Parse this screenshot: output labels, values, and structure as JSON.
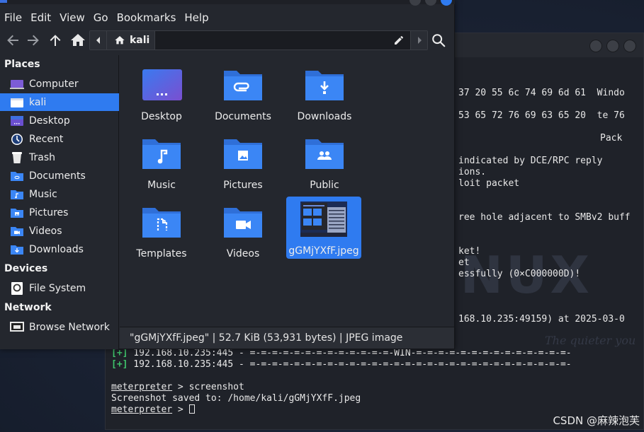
{
  "file_manager": {
    "menu": [
      "File",
      "Edit",
      "View",
      "Go",
      "Bookmarks",
      "Help"
    ],
    "path": {
      "current": "kali"
    },
    "sidebar": {
      "sections": [
        {
          "title": "Places",
          "items": [
            {
              "label": "Computer",
              "icon": "computer-icon"
            },
            {
              "label": "kali",
              "icon": "home-folder-icon",
              "active": true
            },
            {
              "label": "Desktop",
              "icon": "desktop-icon"
            },
            {
              "label": "Recent",
              "icon": "recent-icon"
            },
            {
              "label": "Trash",
              "icon": "trash-icon"
            },
            {
              "label": "Documents",
              "icon": "documents-folder-icon"
            },
            {
              "label": "Music",
              "icon": "music-folder-icon"
            },
            {
              "label": "Pictures",
              "icon": "pictures-folder-icon"
            },
            {
              "label": "Videos",
              "icon": "videos-folder-icon"
            },
            {
              "label": "Downloads",
              "icon": "downloads-folder-icon"
            }
          ]
        },
        {
          "title": "Devices",
          "items": [
            {
              "label": "File System",
              "icon": "drive-icon"
            }
          ]
        },
        {
          "title": "Network",
          "items": [
            {
              "label": "Browse Network",
              "icon": "network-icon"
            }
          ]
        }
      ]
    },
    "grid": [
      {
        "label": "Desktop",
        "icon": "desktop-icon"
      },
      {
        "label": "Documents",
        "icon": "documents-folder-icon"
      },
      {
        "label": "Downloads",
        "icon": "downloads-folder-icon"
      },
      {
        "label": "Music",
        "icon": "music-folder-icon"
      },
      {
        "label": "Pictures",
        "icon": "pictures-folder-icon"
      },
      {
        "label": "Public",
        "icon": "public-folder-icon"
      },
      {
        "label": "Templates",
        "icon": "templates-folder-icon"
      },
      {
        "label": "Videos",
        "icon": "videos-folder-icon"
      },
      {
        "label": "gGMjYXfF.jpeg",
        "icon": "image-thumbnail-icon",
        "selected": true
      }
    ],
    "status": "\"gGMjYXfF.jpeg\" | 52.7 KiB (53,931 bytes) | JPEG image"
  },
  "terminal": {
    "lines": [
      "37 20 55 6c 74 69 6d 61  Windo",
      "53 65 72 76 69 63 65 20  te 76",
      "Pack",
      "indicated by DCE/RPC reply",
      "ions.",
      "loit packet",
      "ree hole adjacent to SMBv2 buff",
      "ket!",
      "et",
      "essfully (0×C000000D)!",
      "168.10.235:49159) at 2025-03-0"
    ],
    "result_lines": [
      {
        "prefix": "[+]",
        "text": " 192.168.10.235:445 - =-=-=-=-=-=-=-=-=-=-=-=-=-WIN-=-=-=-=-=-=-=-=-=-=-=-=-=-=-"
      },
      {
        "prefix": "[+]",
        "text": " 192.168.10.235:445 - =-=-=-=-=-=-=-=-=-=-=-=-=-=-=-=-=-=-=-=-=-=-=-=-=-=-=-=-=-"
      }
    ],
    "prompt": "meterpreter",
    "command": " > screenshot",
    "output": "Screenshot saved to: /home/kali/gGMjYXfF.jpeg",
    "prompt_suffix": " > ",
    "wallpaper_mark": "INUX",
    "wallpaper_slogan": "The quieter you become, the more you are able to hear"
  },
  "watermark": "CSDN @麻辣泡芙",
  "colors": {
    "accent": "#2f7bf0",
    "folder": "#3b86f5",
    "terminal_green": "#3fc36b"
  }
}
